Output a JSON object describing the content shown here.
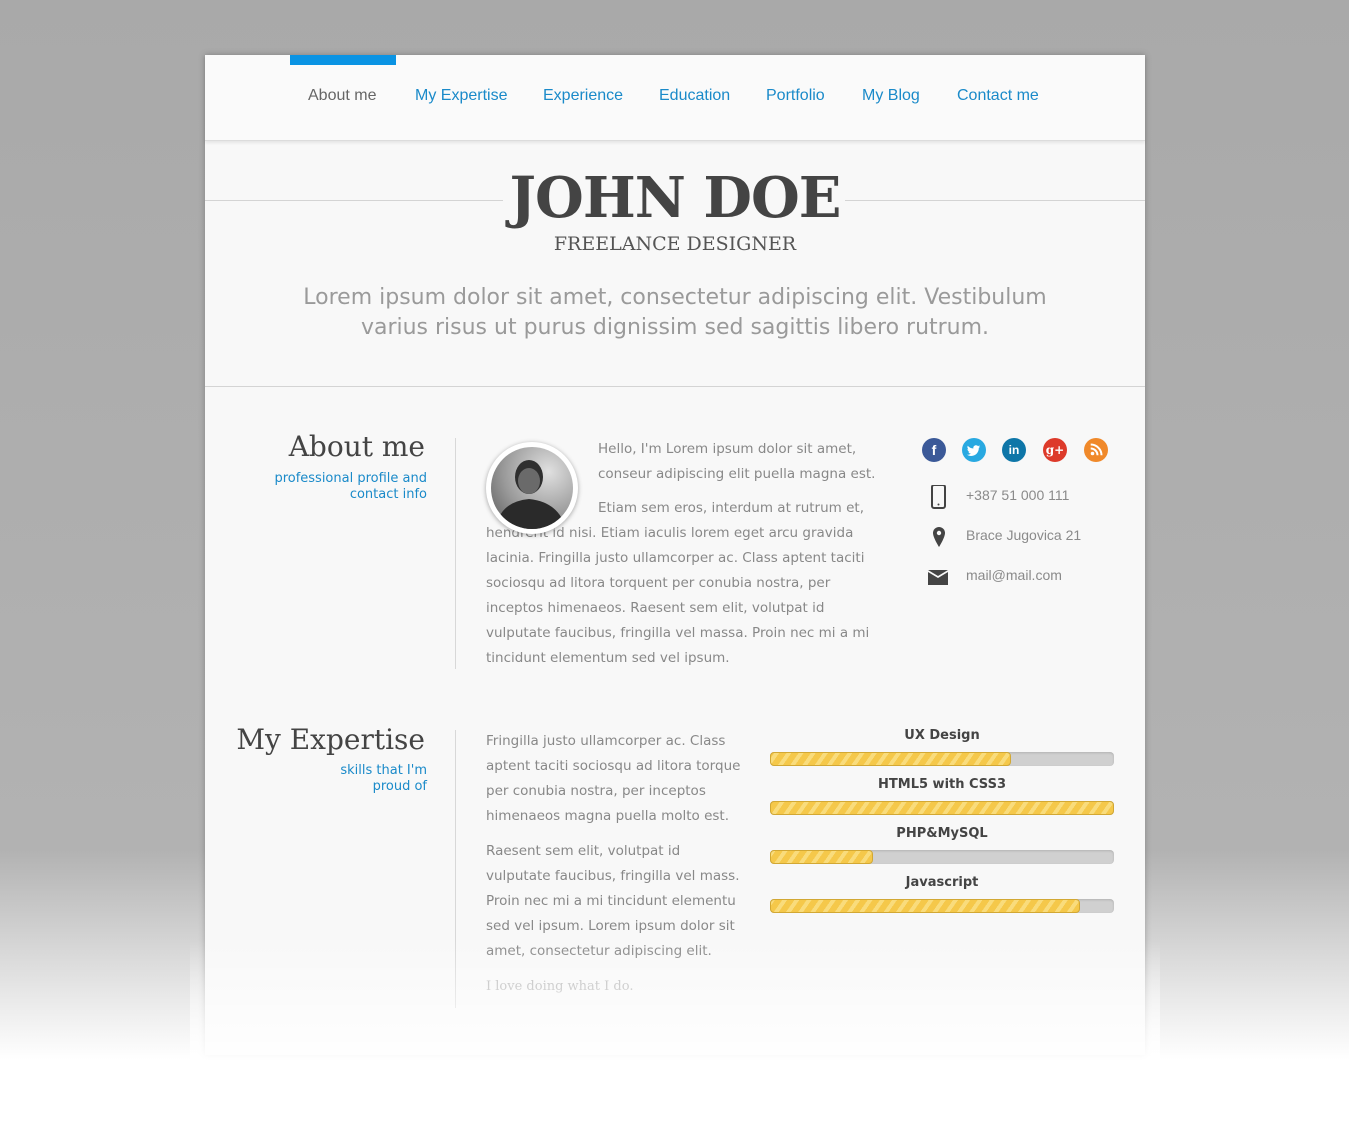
{
  "nav": {
    "items": [
      {
        "label": "About me",
        "active": true
      },
      {
        "label": "My Expertise",
        "active": false
      },
      {
        "label": "Experience",
        "active": false
      },
      {
        "label": "Education",
        "active": false
      },
      {
        "label": "Portfolio",
        "active": false
      },
      {
        "label": "My Blog",
        "active": false
      },
      {
        "label": "Contact me",
        "active": false
      }
    ],
    "accent_color": "#0a93e3"
  },
  "header": {
    "name": "JOHN DOE",
    "title": "FREELANCE DESIGNER",
    "intro": "Lorem ipsum dolor sit amet, consectetur adipiscing elit. Vestibulum varius risus ut purus dignissim sed sagittis libero rutrum."
  },
  "about": {
    "title": "About me",
    "subtitle": "professional profile and contact info",
    "paragraphs": [
      "Hello, I'm Lorem ipsum dolor sit amet, conseur adipiscing elit puella magna est.",
      "Etiam sem eros, interdum at rutrum et, hendrerit id nisi. Etiam iaculis lorem eget arcu gravida lacinia. Fringilla justo ullamcorper ac. Class aptent taciti sociosqu ad litora torquent per conubia nostra, per inceptos himenaeos. Raesent sem elit, volutpat id vulputate faucibus, fringilla vel massa. Proin nec mi a mi tincidunt elementum sed vel ipsum."
    ],
    "social": [
      {
        "name": "facebook",
        "glyph": "f",
        "color": "#3b5998"
      },
      {
        "name": "twitter",
        "glyph": "t",
        "color": "#29a9e1"
      },
      {
        "name": "linkedin",
        "glyph": "in",
        "color": "#0e76a8"
      },
      {
        "name": "google-plus",
        "glyph": "g+",
        "color": "#dd3a2a"
      },
      {
        "name": "rss",
        "glyph": "rss",
        "color": "#f0892a"
      }
    ],
    "contact": {
      "phone": "+387 51 000 111",
      "address": "Brace Jugovica 21",
      "email": "mail@mail.com"
    }
  },
  "expertise": {
    "title": "My Expertise",
    "subtitle": "skills that I'm proud of",
    "paragraphs": [
      "Fringilla justo ullamcorper ac. Class aptent taciti sociosqu ad litora torque per conubia nostra, per inceptos himenaeos magna puella molto est.",
      "Raesent sem elit, volutpat id vulputate faucibus, fringilla vel mass. Proin nec mi a mi tincidunt elementu sed vel ipsum. Lorem ipsum dolor sit amet, consectetur adipiscing elit."
    ],
    "tagline": "I love doing what I do.",
    "skills": [
      {
        "label": "UX Design",
        "percent": 70
      },
      {
        "label": "HTML5 with CSS3",
        "percent": 100
      },
      {
        "label": "PHP&MySQL",
        "percent": 30
      },
      {
        "label": "Javascript",
        "percent": 90
      }
    ]
  }
}
